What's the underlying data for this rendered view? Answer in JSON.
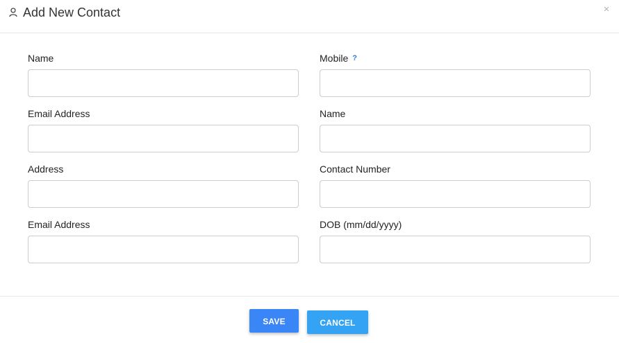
{
  "modal": {
    "title": "Add New Contact",
    "icon": "user-icon",
    "close_label": "×"
  },
  "form": {
    "rows": [
      {
        "left": {
          "label": "Name",
          "value": "",
          "placeholder": ""
        },
        "right": {
          "label": "Mobile",
          "value": "",
          "placeholder": "",
          "help": "?"
        }
      },
      {
        "left": {
          "label": "Email Address",
          "value": "",
          "placeholder": ""
        },
        "right": {
          "label": "Name",
          "value": "",
          "placeholder": ""
        }
      },
      {
        "left": {
          "label": "Address",
          "value": "",
          "placeholder": ""
        },
        "right": {
          "label": "Contact Number",
          "value": "",
          "placeholder": ""
        }
      },
      {
        "left": {
          "label": "Email Address",
          "value": "",
          "placeholder": ""
        },
        "right": {
          "label": "DOB (mm/dd/yyyy)",
          "value": "",
          "placeholder": ""
        }
      }
    ]
  },
  "footer": {
    "save_label": "SAVE",
    "cancel_label": "CANCEL"
  },
  "colors": {
    "save_button": "#3b86f7",
    "cancel_button": "#35a3f4",
    "help_icon": "#2f7dd8",
    "border": "#cccccc"
  }
}
